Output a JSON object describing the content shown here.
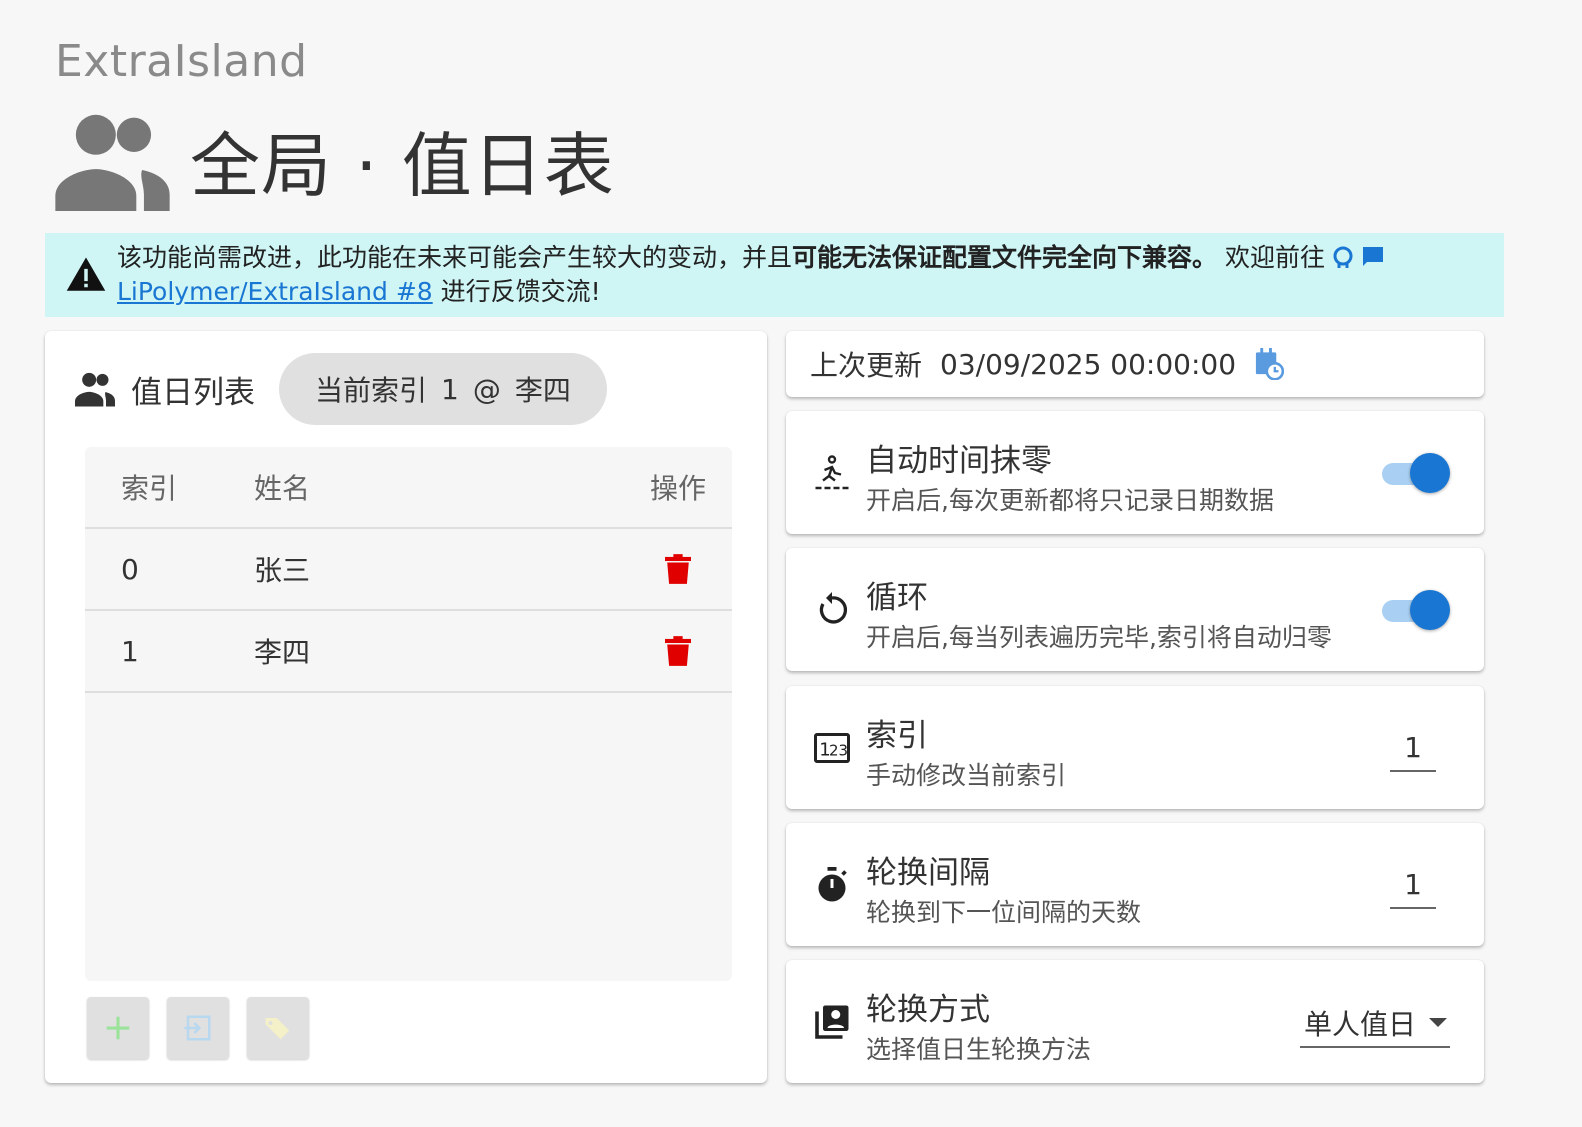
{
  "app": {
    "name": "ExtraIsland"
  },
  "page": {
    "title": "全局 · 值日表"
  },
  "banner": {
    "text1": "该功能尚需改进，此功能在未来可能会产生较大的变动，并且",
    "bold": "可能无法保证配置文件完全向下兼容。",
    "text2": "欢迎前往",
    "link": "LiPolymer/ExtraIsland #8",
    "text3": "进行反馈交流!"
  },
  "list": {
    "title": "值日列表",
    "chip_label": "当前索引",
    "chip_index": "1",
    "chip_at": "@",
    "chip_name": "李四",
    "columns": {
      "index": "索引",
      "name": "姓名",
      "op": "操作"
    },
    "rows": [
      {
        "index": "0",
        "name": "张三"
      },
      {
        "index": "1",
        "name": "李四"
      }
    ]
  },
  "update": {
    "label": "上次更新",
    "value": "03/09/2025 00:00:00"
  },
  "settings": {
    "auto_zero": {
      "title": "自动时间抹零",
      "desc": "开启后,每次更新都将只记录日期数据",
      "on": true
    },
    "loop": {
      "title": "循环",
      "desc": "开启后,每当列表遍历完毕,索引将自动归零",
      "on": true
    },
    "index": {
      "title": "索引",
      "desc": "手动修改当前索引",
      "value": "1"
    },
    "interval": {
      "title": "轮换间隔",
      "desc": "轮换到下一位间隔的天数",
      "value": "1"
    },
    "mode": {
      "title": "轮换方式",
      "desc": "选择值日生轮换方法",
      "value": "单人值日"
    }
  },
  "colors": {
    "accent": "#1976d2",
    "banner_bg": "#cff5f5",
    "delete": "#e00000"
  },
  "icons": [
    "people-icon",
    "warning-icon",
    "github-icon",
    "message-icon",
    "trash-icon",
    "add-icon",
    "import-icon",
    "tags-icon",
    "calendar-clock-icon",
    "run-icon",
    "loop-icon",
    "numeric-icon",
    "timer-icon",
    "account-box-icon"
  ]
}
